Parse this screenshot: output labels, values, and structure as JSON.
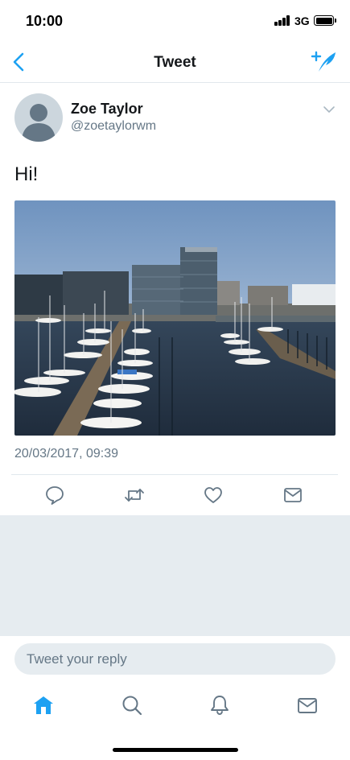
{
  "status_bar": {
    "time": "10:00",
    "network": "3G"
  },
  "nav": {
    "title": "Tweet",
    "icons": {
      "back": "chevron-left-icon",
      "compose": "compose-tweet-icon"
    }
  },
  "tweet": {
    "author_name": "Zoe Taylor",
    "author_handle": "@zoetaylorwm",
    "text": "Hi!",
    "timestamp": "20/03/2017, 09:39",
    "photo": "harbor-marina-photo",
    "actions": [
      "reply-icon",
      "retweet-icon",
      "like-icon",
      "message-icon"
    ]
  },
  "reply": {
    "placeholder": "Tweet your reply"
  },
  "tab_bar": {
    "items": [
      "home-icon",
      "search-icon",
      "notifications-icon",
      "messages-icon"
    ],
    "active": "home-icon"
  },
  "colors": {
    "accent": "#1da1f2",
    "icon_gray": "#657786",
    "background_gray": "#e6ecf0",
    "divider": "#e1e8ed"
  }
}
